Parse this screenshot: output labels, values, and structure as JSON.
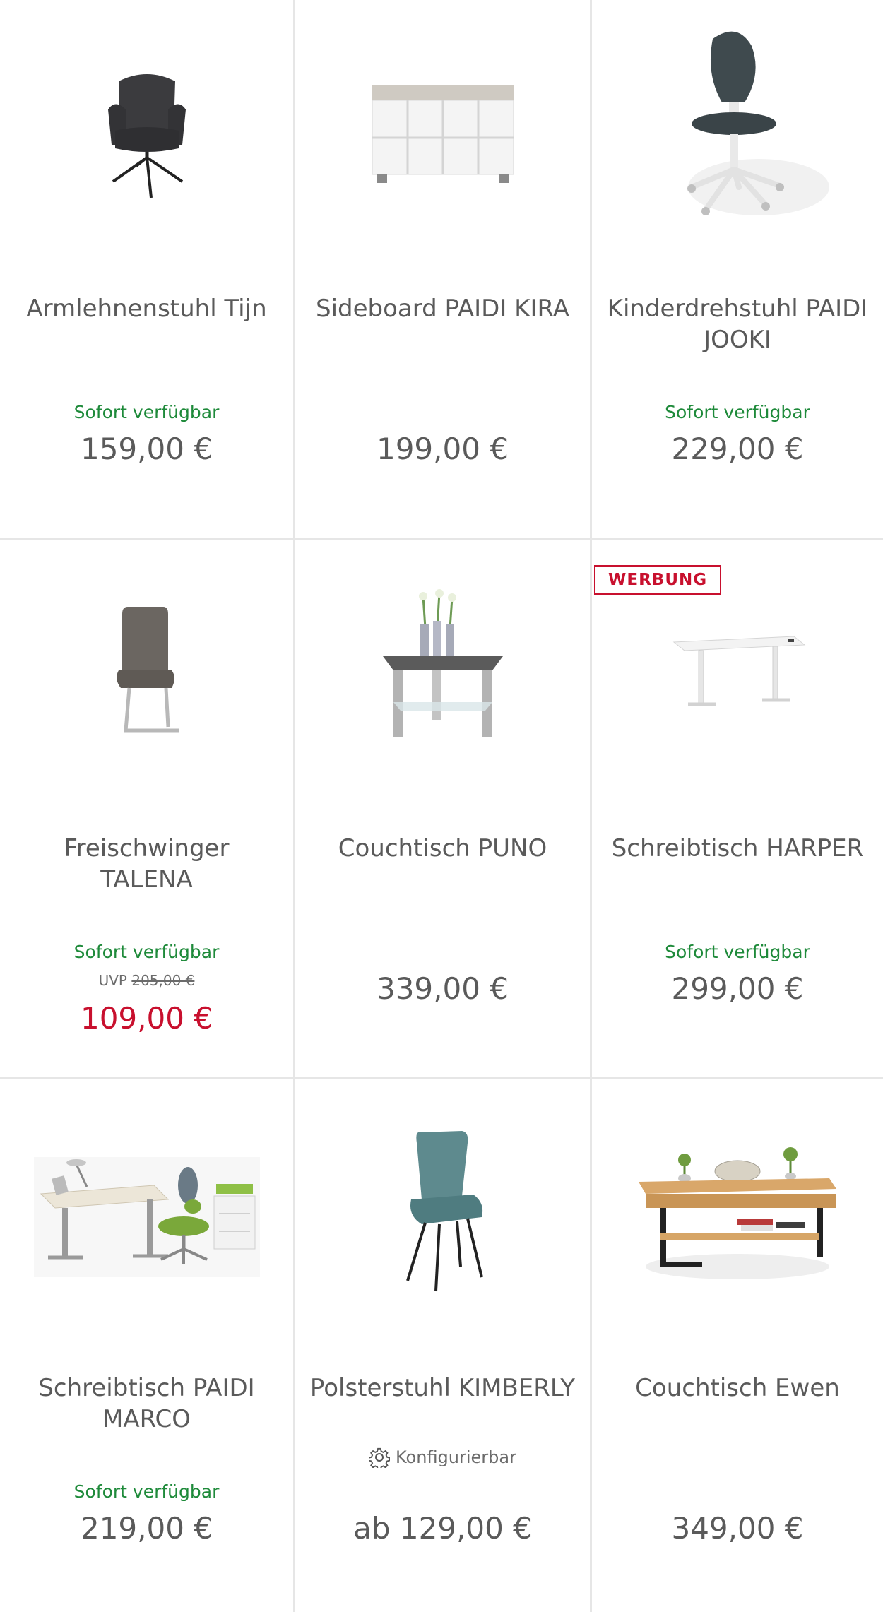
{
  "products": [
    {
      "title": "Armlehnenstuhl Tijn",
      "availability": "Sofort verfügbar",
      "price": "159,00 €",
      "image": "armchair-swivel-image"
    },
    {
      "title": "Sideboard PAIDI KIRA",
      "availability": "",
      "price": "199,00 €",
      "image": "sideboard-image"
    },
    {
      "title": "Kinderdrehstuhl PAIDI JOOKI",
      "availability": "Sofort verfügbar",
      "price": "229,00 €",
      "image": "kids-office-chair-image"
    },
    {
      "title": "Freischwinger TALENA",
      "availability": "Sofort verfügbar",
      "uvp_label": "UVP",
      "uvp_price": "205,00 €",
      "price": "109,00 €",
      "image": "cantilever-chair-image"
    },
    {
      "title": "Couchtisch PUNO",
      "availability": "",
      "price": "339,00 €",
      "image": "glass-coffee-table-image"
    },
    {
      "badge": "WERBUNG",
      "title": "Schreibtisch HARPER",
      "availability": "Sofort verfügbar",
      "price": "299,00 €",
      "image": "standing-desk-image"
    },
    {
      "title": "Schreibtisch PAIDI MARCO",
      "availability": "Sofort verfügbar",
      "price": "219,00 €",
      "image": "kids-desk-set-image"
    },
    {
      "title": "Polsterstuhl KIMBERLY",
      "configurable": "Konfigurierbar",
      "availability": "",
      "price": "ab 129,00 €",
      "image": "upholstered-chair-image"
    },
    {
      "title": "Couchtisch Ewen",
      "availability": "",
      "price": "349,00 €",
      "image": "wood-coffee-table-image"
    }
  ],
  "colors": {
    "available": "#1e8a3a",
    "sale": "#c8102e",
    "text": "#5a5a5a",
    "divider": "#e6e6e6"
  }
}
